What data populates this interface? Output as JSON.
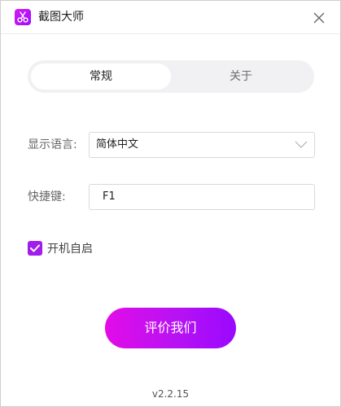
{
  "app": {
    "title": "截图大师",
    "icon": "scissors-icon",
    "accent_color": "#a11dea"
  },
  "titlebar": {
    "close_icon": "close-icon"
  },
  "tabs": [
    {
      "label": "常规",
      "active": true
    },
    {
      "label": "关于",
      "active": false
    }
  ],
  "settings": {
    "language_label": "显示语言:",
    "language_value": "简体中文",
    "hotkey_label": "快捷键:",
    "hotkey_value": "F1",
    "autostart_label": "开机自启",
    "autostart_checked": true
  },
  "rate_button": {
    "label": "评价我们"
  },
  "version": "v2.2.15"
}
